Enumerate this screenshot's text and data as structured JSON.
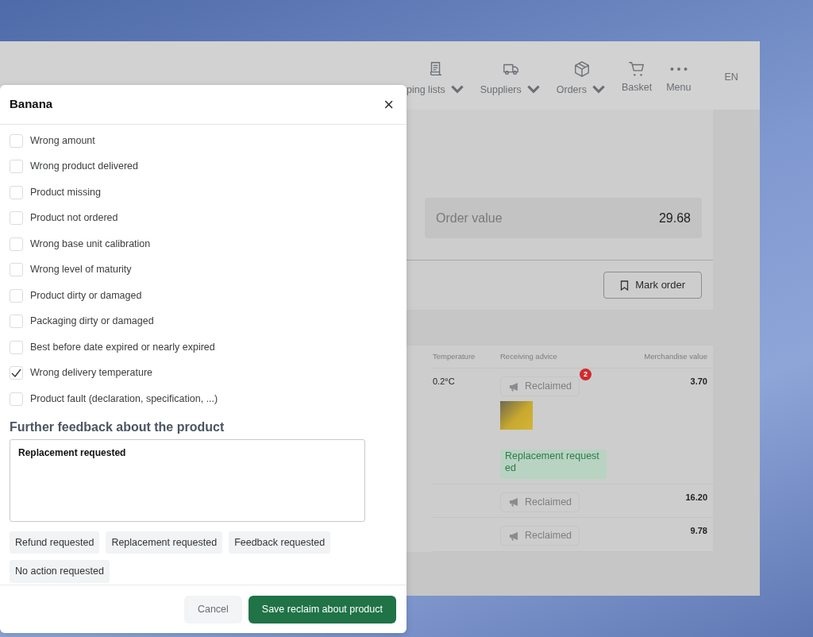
{
  "app": {
    "nav": [
      {
        "label": "ping lists",
        "dropdown": true
      },
      {
        "label": "Suppliers",
        "dropdown": true
      },
      {
        "label": "Orders",
        "dropdown": true
      },
      {
        "label": "Basket",
        "dropdown": false
      },
      {
        "label": "Menu",
        "dropdown": false
      }
    ],
    "language": "EN",
    "order_value": {
      "label": "Order value",
      "value": "29.68"
    },
    "mark_order_button": "Mark order",
    "table": {
      "columns": [
        "Temperature",
        "Receiving advice",
        "Merchandise value"
      ],
      "rows": [
        {
          "temperature": "0.2°C",
          "advice": "Reclaimed",
          "badge_count": "2",
          "has_photo": true,
          "note": "Replacement requested",
          "value": "3.70"
        },
        {
          "advice": "Reclaimed",
          "has_photo": false,
          "value": "16.20"
        },
        {
          "advice": "Reclaimed",
          "has_photo": false,
          "value": "9.78"
        }
      ]
    }
  },
  "dialog": {
    "title": "Banana",
    "close": "×",
    "reasons": [
      {
        "label": "Wrong amount",
        "checked": false
      },
      {
        "label": "Wrong product delivered",
        "checked": false
      },
      {
        "label": "Product missing",
        "checked": false
      },
      {
        "label": "Product not ordered",
        "checked": false
      },
      {
        "label": "Wrong base unit calibration",
        "checked": false
      },
      {
        "label": "Wrong level of maturity",
        "checked": false
      },
      {
        "label": "Product dirty or damaged",
        "checked": false
      },
      {
        "label": "Packaging dirty or damaged",
        "checked": false
      },
      {
        "label": "Best before date expired or nearly expired",
        "checked": false
      },
      {
        "label": "Wrong delivery temperature",
        "checked": true
      },
      {
        "label": "Product fault (declaration, specification, ...)",
        "checked": false
      }
    ],
    "feedback_heading": "Further feedback about the product",
    "feedback_value": "Replacement requested",
    "quick_replies": [
      "Refund requested",
      "Replacement requested",
      "Feedback requested",
      "No action requested"
    ],
    "cancel_button": "Cancel",
    "save_button": "Save reclaim about product"
  }
}
